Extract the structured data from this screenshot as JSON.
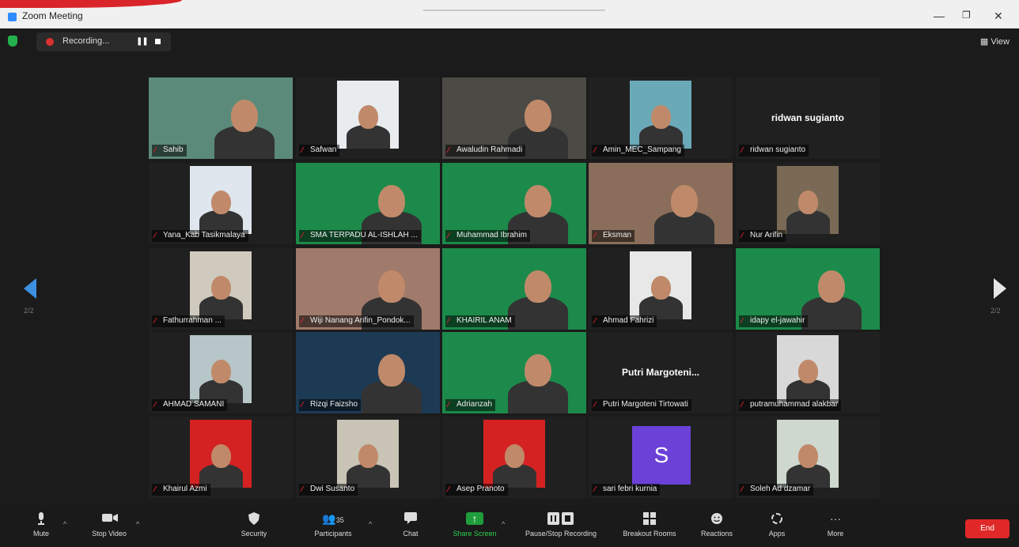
{
  "window": {
    "title": "Zoom Meeting",
    "minimize": "—",
    "restore": "❐",
    "close": "✕"
  },
  "recording": {
    "label": "Recording..."
  },
  "view": {
    "label": "View"
  },
  "pager": {
    "left": "2/2",
    "right": "2/2"
  },
  "tiles": [
    {
      "name": "Sahib",
      "type": "video",
      "bg": "#5c8a7a"
    },
    {
      "name": "Safwan",
      "type": "video",
      "bg": "#e9ecef"
    },
    {
      "name": "Awaludin Rahmadi",
      "type": "video",
      "bg": "#4b4a45"
    },
    {
      "name": "Amin_MEC_Sampang",
      "type": "video",
      "bg": "#6aa9b8"
    },
    {
      "name": "ridwan sugianto",
      "type": "name",
      "bigname": "ridwan sugianto"
    },
    {
      "name": "Yana_Kab Tasikmalaya",
      "type": "video",
      "bg": "#dfe6ee"
    },
    {
      "name": "SMA TERPADU AL-ISHLAH ...",
      "type": "video",
      "bg": "#1c8a4a"
    },
    {
      "name": "Muhammad Ibrahim",
      "type": "video",
      "bg": "#1c8a4a"
    },
    {
      "name": "Eksman",
      "type": "video",
      "bg": "#8a6d5a"
    },
    {
      "name": "Nur Arifin",
      "type": "video",
      "bg": "#7a6a55"
    },
    {
      "name": "Fathurrahman ...",
      "type": "video",
      "bg": "#cfcabd"
    },
    {
      "name": "Wiji Nanang Arifin_Pondok...",
      "type": "video",
      "bg": "#a07a6a"
    },
    {
      "name": "KHAIRIL ANAM",
      "type": "video",
      "bg": "#1c8a4a"
    },
    {
      "name": "Ahmad Fahrizi",
      "type": "video",
      "bg": "#e8e8e8"
    },
    {
      "name": "idapy el-jawahir",
      "type": "video",
      "bg": "#1c8a4a"
    },
    {
      "name": "AHMAD SAMANI",
      "type": "video",
      "bg": "#b7c6c8"
    },
    {
      "name": "Rizqi Faizsho",
      "type": "video",
      "bg": "#1d3a55"
    },
    {
      "name": "Adrianzah",
      "type": "video",
      "bg": "#1c8a4a"
    },
    {
      "name": "Putri Margoteni Tirtowati",
      "type": "name",
      "bigname": "Putri Margoteni..."
    },
    {
      "name": "putramuhammad alakbar",
      "type": "video",
      "bg": "#d8d8d8"
    },
    {
      "name": "Khairul Azmi",
      "type": "video",
      "bg": "#d42222"
    },
    {
      "name": "Dwi Susanto",
      "type": "video",
      "bg": "#c9c4b6"
    },
    {
      "name": "Asep Pranoto",
      "type": "video",
      "bg": "#d42222"
    },
    {
      "name": "sari febri kurnia",
      "type": "letter",
      "letter": "S"
    },
    {
      "name": "Soleh Ad dzamar",
      "type": "video",
      "bg": "#cfd8cf"
    }
  ],
  "toolbar": {
    "mute": "Mute",
    "stop_video": "Stop Video",
    "security": "Security",
    "participants": "Participants",
    "participants_count": "35",
    "chat": "Chat",
    "share_screen": "Share Screen",
    "pause_stop_recording": "Pause/Stop Recording",
    "breakout_rooms": "Breakout Rooms",
    "reactions": "Reactions",
    "apps": "Apps",
    "more": "More",
    "end": "End"
  }
}
